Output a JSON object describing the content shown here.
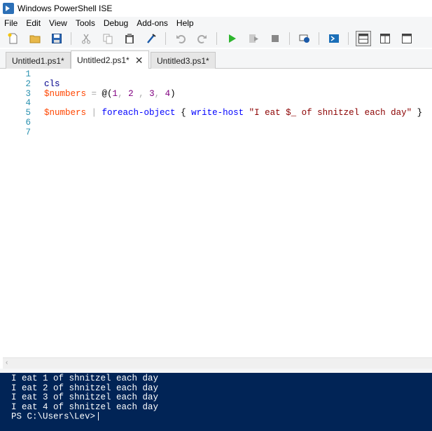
{
  "window": {
    "title": "Windows PowerShell ISE"
  },
  "menu": [
    "File",
    "Edit",
    "View",
    "Tools",
    "Debug",
    "Add-ons",
    "Help"
  ],
  "toolbar": {
    "buttons": [
      "new-file-icon",
      "open-folder-icon",
      "save-icon",
      "cut-icon",
      "copy-icon",
      "paste-icon",
      "clear-console-icon",
      "undo-icon",
      "redo-icon",
      "run-icon",
      "run-selection-icon",
      "stop-icon",
      "remote-tab-icon",
      "powershell-console-icon",
      "layout-top-icon",
      "layout-right-icon",
      "layout-max-icon"
    ]
  },
  "tabs": [
    {
      "label": "Untitled1.ps1*",
      "active": false
    },
    {
      "label": "Untitled2.ps1*",
      "active": true,
      "close": "✕"
    },
    {
      "label": "Untitled3.ps1*",
      "active": false
    }
  ],
  "editor": {
    "line_numbers": [
      "1",
      "2",
      "3",
      "4",
      "5",
      "6",
      "7"
    ],
    "lines": [
      [],
      [
        {
          "t": "cls",
          "c": "kw"
        }
      ],
      [
        {
          "t": "$numbers",
          "c": "var"
        },
        {
          "t": " = ",
          "c": "op"
        },
        {
          "t": "@(",
          "c": "grp"
        },
        {
          "t": "1",
          "c": "num"
        },
        {
          "t": ", ",
          "c": "op"
        },
        {
          "t": "2",
          "c": "num"
        },
        {
          "t": " , ",
          "c": "op"
        },
        {
          "t": "3",
          "c": "num"
        },
        {
          "t": ", ",
          "c": "op"
        },
        {
          "t": "4",
          "c": "num"
        },
        {
          "t": ")",
          "c": "grp"
        }
      ],
      [],
      [
        {
          "t": "$numbers",
          "c": "var"
        },
        {
          "t": " | ",
          "c": "op"
        },
        {
          "t": "foreach-object",
          "c": "cmd"
        },
        {
          "t": " { ",
          "c": "grp"
        },
        {
          "t": "write-host",
          "c": "cmd"
        },
        {
          "t": " ",
          "c": "grp"
        },
        {
          "t": "\"I eat $_ of shnitzel each day\"",
          "c": "str"
        },
        {
          "t": " }",
          "c": "grp"
        }
      ],
      [],
      []
    ]
  },
  "console": {
    "output": [
      "I eat 1 of shnitzel each day",
      "I eat 2 of shnitzel each day",
      "I eat 3 of shnitzel each day",
      "I eat 4 of shnitzel each day"
    ],
    "prompt": "PS C:\\Users\\Lev>"
  },
  "colors": {
    "console_bg": "#012456",
    "variable": "#ff4500",
    "command": "#0000ff",
    "string": "#8b0000",
    "number": "#800080",
    "line_number": "#2b91af"
  }
}
